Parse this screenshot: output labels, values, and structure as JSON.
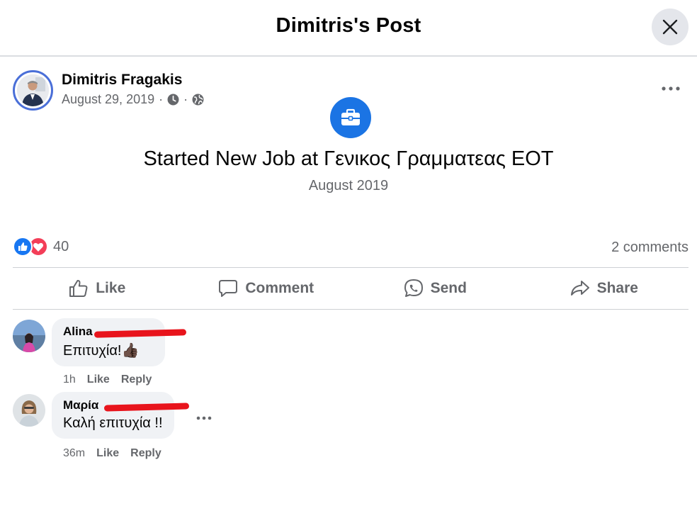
{
  "header": {
    "title": "Dimitris's Post"
  },
  "post": {
    "author": "Dimitris Fragakis",
    "date": "August 29, 2019",
    "separator": "·",
    "event_title": "Started New Job at Γενικος Γραμματεας ΕΟΤ",
    "event_date": "August 2019"
  },
  "stats": {
    "reaction_count": "40",
    "comments_label": "2 comments"
  },
  "actions": {
    "like": "Like",
    "comment": "Comment",
    "send": "Send",
    "share": "Share"
  },
  "comments": [
    {
      "name": "Alina",
      "text": "Επιτυχία!",
      "emoji": "👍🏿",
      "time": "1h",
      "like": "Like",
      "reply": "Reply"
    },
    {
      "name": "Μαρία",
      "text": "Καλή επιτυχία !!",
      "time": "36m",
      "like": "Like",
      "reply": "Reply"
    }
  ],
  "colors": {
    "accent": "#1b74e4",
    "like_blue": "#1877f2",
    "love_red": "#f33e58",
    "secondary_text": "#65676b",
    "bubble": "#f0f2f5",
    "redaction": "#e8141c"
  },
  "icons": [
    "close-icon",
    "clock-icon",
    "globe-icon",
    "more-icon",
    "briefcase-icon",
    "like-reaction-icon",
    "love-reaction-icon",
    "thumbs-up-icon",
    "comment-icon",
    "send-icon",
    "share-icon"
  ]
}
